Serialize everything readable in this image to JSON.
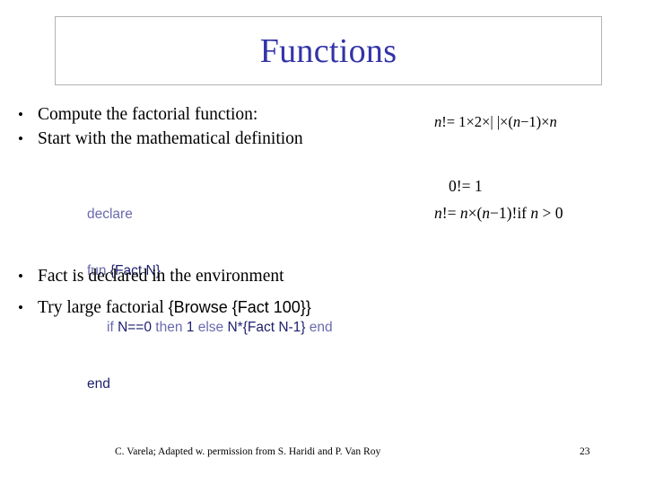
{
  "slide": {
    "title": "Functions",
    "title_color": "#3333a8",
    "background_color": "#ffffff"
  },
  "bullets": [
    {
      "marker": "•",
      "text": "Compute the factorial function:"
    },
    {
      "marker": "•",
      "text": "Start with the mathematical definition"
    },
    {
      "marker": "•",
      "text": "Fact is declared in the environment"
    },
    {
      "marker": "•",
      "text_serif": "Try large factorial ",
      "text_sans": "{Browse {Fact 100}}"
    }
  ],
  "code": {
    "keyword_color": "#6a6aae",
    "identifier_color": "#1e1e6e",
    "lines": [
      {
        "keyword": "declare",
        "rest": ""
      },
      {
        "keyword": "fun ",
        "rest": "{Fact N}"
      },
      {
        "indent": true,
        "t1": "if ",
        "t2": "N==0 ",
        "t3": "then ",
        "t4": "1 ",
        "t5": "else ",
        "t6": "N*{Fact N-1} ",
        "t7": "end"
      },
      {
        "keyword": "end",
        "rest": ""
      }
    ]
  },
  "math": {
    "formula_1": {
      "lhs_var": "n",
      "lhs_rest": "!= 1",
      "mul_1": "×",
      "term_2": "2",
      "mul_2": "×",
      "ellipsis": "| |",
      "mul_3": "×",
      "paren": "(",
      "var_n": "n",
      "minus_one": "−1)",
      "mul_4": "×",
      "var_n2": "n",
      "full": "n!= 1×2×| |×(n−1)×n"
    },
    "formula_2": {
      "full": "0!= 1"
    },
    "formula_3": {
      "lhs": "n",
      "eq": "!= ",
      "n1": "n",
      "mul": "×(",
      "n2": "n",
      "tail": "−1)!",
      "cond_if": "if ",
      "cond_n": "n",
      "cond_rest": " > 0",
      "full": "n!= n×(n−1)! if n > 0"
    }
  },
  "footer": {
    "credit": "C. Varela;  Adapted w. permission from S. Haridi and P. Van Roy",
    "page_number": "23"
  }
}
